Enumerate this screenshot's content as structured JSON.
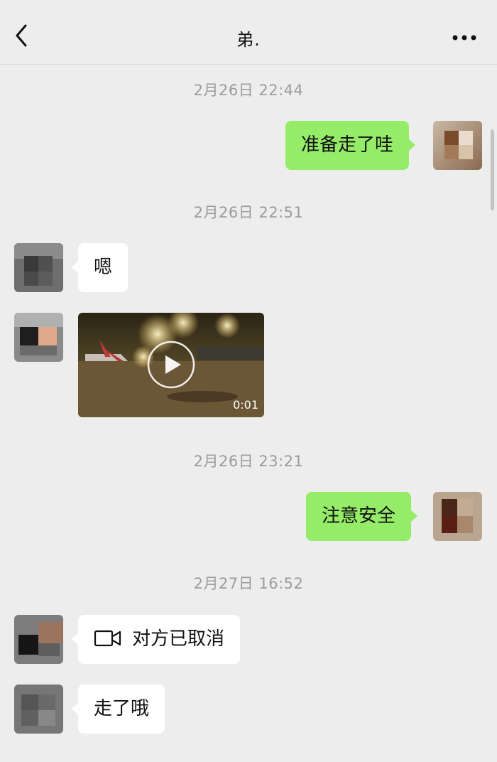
{
  "header": {
    "title": "弟.",
    "back_icon": "chevron-left-icon",
    "more_icon": "ellipsis-icon"
  },
  "timestamps": [
    "2月26日 22:44",
    "2月26日 22:51",
    "2月26日 23:21",
    "2月27日 16:52"
  ],
  "messages": [
    {
      "direction": "out",
      "text": "准备走了哇"
    },
    {
      "direction": "in",
      "text": "嗯"
    },
    {
      "direction": "in",
      "type": "video",
      "duration": "0:01"
    },
    {
      "direction": "out",
      "text": "注意安全"
    },
    {
      "direction": "in",
      "type": "call",
      "text": "对方已取消",
      "icon": "video-call-icon"
    },
    {
      "direction": "in",
      "text": "走了哦"
    }
  ],
  "colors": {
    "background": "#ededed",
    "outgoing_bubble": "#95ec69",
    "incoming_bubble": "#ffffff",
    "timestamp_text": "#9b9b9b"
  }
}
